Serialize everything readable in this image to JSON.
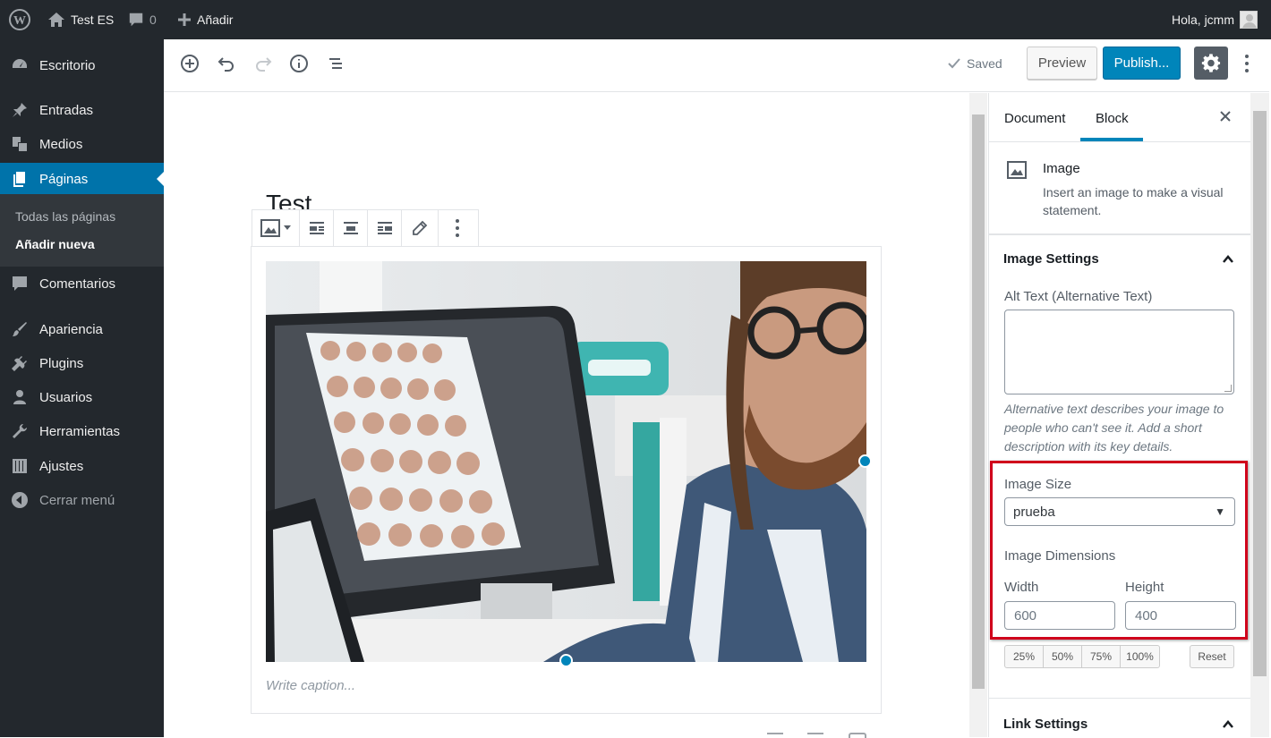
{
  "admin_bar": {
    "site_name": "Test ES",
    "comments_count": "0",
    "add_new": "Añadir",
    "greeting": "Hola, jcmm"
  },
  "sidebar": {
    "items": [
      {
        "label": "Escritorio",
        "icon": "dashboard-icon"
      },
      {
        "label": "Entradas",
        "icon": "pin-icon"
      },
      {
        "label": "Medios",
        "icon": "media-icon"
      },
      {
        "label": "Páginas",
        "icon": "pages-icon",
        "active": true
      },
      {
        "label": "Comentarios",
        "icon": "comment-icon"
      },
      {
        "label": "Apariencia",
        "icon": "brush-icon"
      },
      {
        "label": "Plugins",
        "icon": "plug-icon"
      },
      {
        "label": "Usuarios",
        "icon": "user-icon"
      },
      {
        "label": "Herramientas",
        "icon": "wrench-icon"
      },
      {
        "label": "Ajustes",
        "icon": "sliders-icon"
      },
      {
        "label": "Cerrar menú",
        "icon": "collapse-icon"
      }
    ],
    "submenu": [
      "Todas las páginas",
      "Añadir nueva"
    ]
  },
  "header": {
    "saved_label": "Saved",
    "preview_label": "Preview",
    "publish_label": "Publish..."
  },
  "editor": {
    "post_title": "Test",
    "caption_placeholder": "Write caption..."
  },
  "settings": {
    "tabs": [
      "Document",
      "Block"
    ],
    "active_tab": "Block",
    "block_name": "Image",
    "block_description": "Insert an image to make a visual statement.",
    "image_settings_title": "Image Settings",
    "alt_text_label": "Alt Text (Alternative Text)",
    "alt_text_value": "",
    "alt_text_help": "Alternative text describes your image to people who can't see it. Add a short description with its key details.",
    "image_size_label": "Image Size",
    "image_size_value": "prueba",
    "image_dimensions_label": "Image Dimensions",
    "width_label": "Width",
    "width_placeholder": "600",
    "height_label": "Height",
    "height_placeholder": "400",
    "percent_buttons": [
      "25%",
      "50%",
      "75%",
      "100%"
    ],
    "reset_label": "Reset",
    "link_settings_title": "Link Settings"
  },
  "colors": {
    "admin_dark": "#23282d",
    "accent": "#0073aa",
    "publish": "#0085ba",
    "highlight_box": "#d0021b"
  }
}
